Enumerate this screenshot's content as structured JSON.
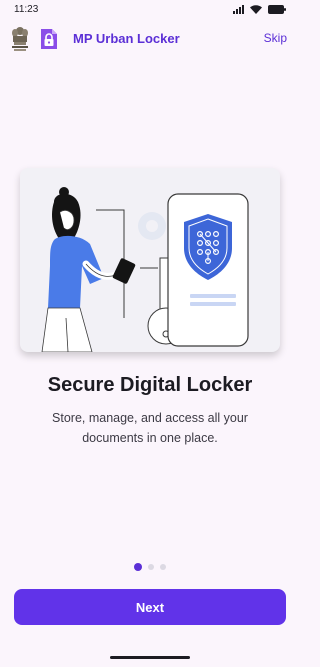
{
  "status_bar": {
    "time": "11:23"
  },
  "header": {
    "app_title": "MP Urban Locker",
    "skip_label": "Skip",
    "emblem_icon": "state-emblem-icon",
    "logo_icon": "lock-badge-icon"
  },
  "onboarding": {
    "illustration": "woman-phone-secure-locker-illustration",
    "title": "Secure Digital Locker",
    "description": "Store, manage, and access all your documents in one place.",
    "page_count": 3,
    "active_page": 1
  },
  "actions": {
    "next_label": "Next"
  },
  "colors": {
    "accent": "#6133e9",
    "title_purple": "#5b2fd6",
    "background": "#fbf5fc",
    "shield_blue": "#3d66d8",
    "shirt_blue": "#4a7be8"
  }
}
